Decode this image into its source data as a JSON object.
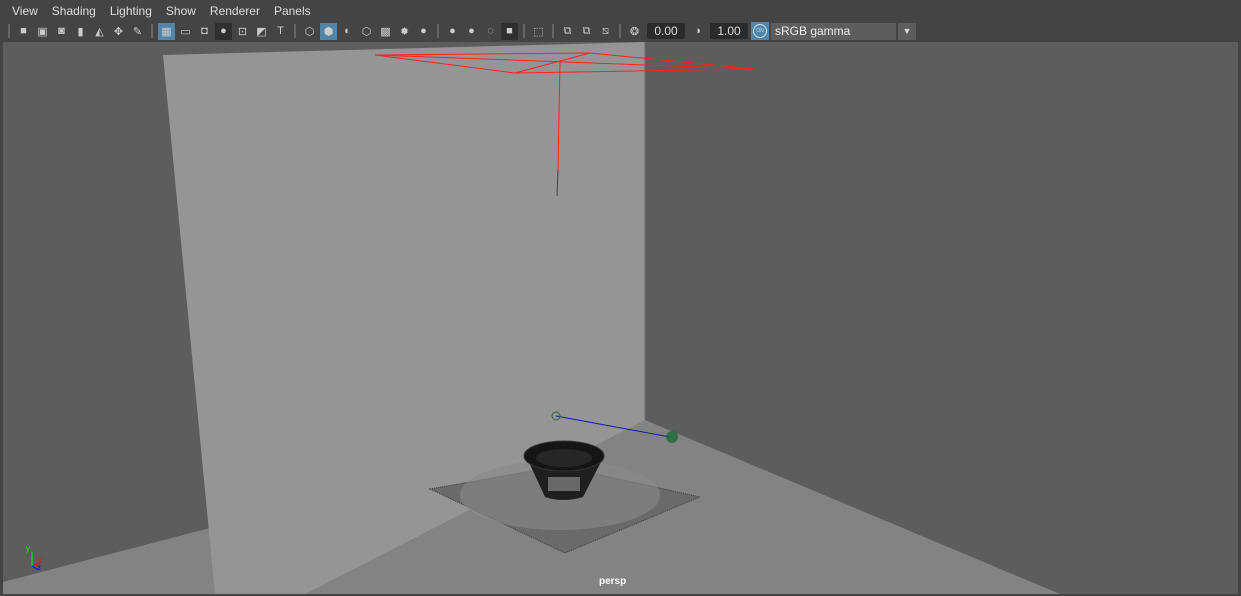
{
  "menu": [
    "View",
    "Shading",
    "Lighting",
    "Show",
    "Renderer",
    "Panels"
  ],
  "toolbar": {
    "groups": [
      [
        "camera-icon",
        "lock-camera-icon",
        "camera-attributes-icon",
        "bookmark-icon",
        "image-plane-icon",
        "2d-pan-zoom-icon",
        "grease-pencil-icon"
      ],
      [
        "grid-icon",
        "film-gate-icon",
        "resolution-gate-icon",
        "gate-mask-icon",
        "field-chart-icon",
        "safe-action-icon",
        "safe-title-icon"
      ],
      [
        "wireframe-icon",
        "smooth-shade-icon",
        "default-material-icon",
        "wireframe-on-shaded-icon",
        "textured-icon",
        "use-all-lights-icon",
        "shadows-icon"
      ],
      [
        "screen-space-ao-icon",
        "motion-blur-icon",
        "anti-aliasing-icon",
        "depth-of-field-icon"
      ],
      [
        "isolate-select-icon"
      ],
      [
        "xray-icon",
        "xray-active-icon",
        "xray-joints-icon"
      ]
    ],
    "active_icons": [
      "grid-icon",
      "smooth-shade-icon"
    ],
    "exposure": "0.00",
    "gamma": "1.00",
    "color_management_on": "ON",
    "color_space": "sRGB gamma"
  },
  "viewport": {
    "camera": "persp",
    "axis": {
      "x": "x",
      "y": "y",
      "z": "z"
    },
    "colors": {
      "back_wall": "#959595",
      "side_wall": "#5d5d5d",
      "floor": "#838383",
      "light": "#ff0000",
      "accent": "#5285a6"
    }
  }
}
